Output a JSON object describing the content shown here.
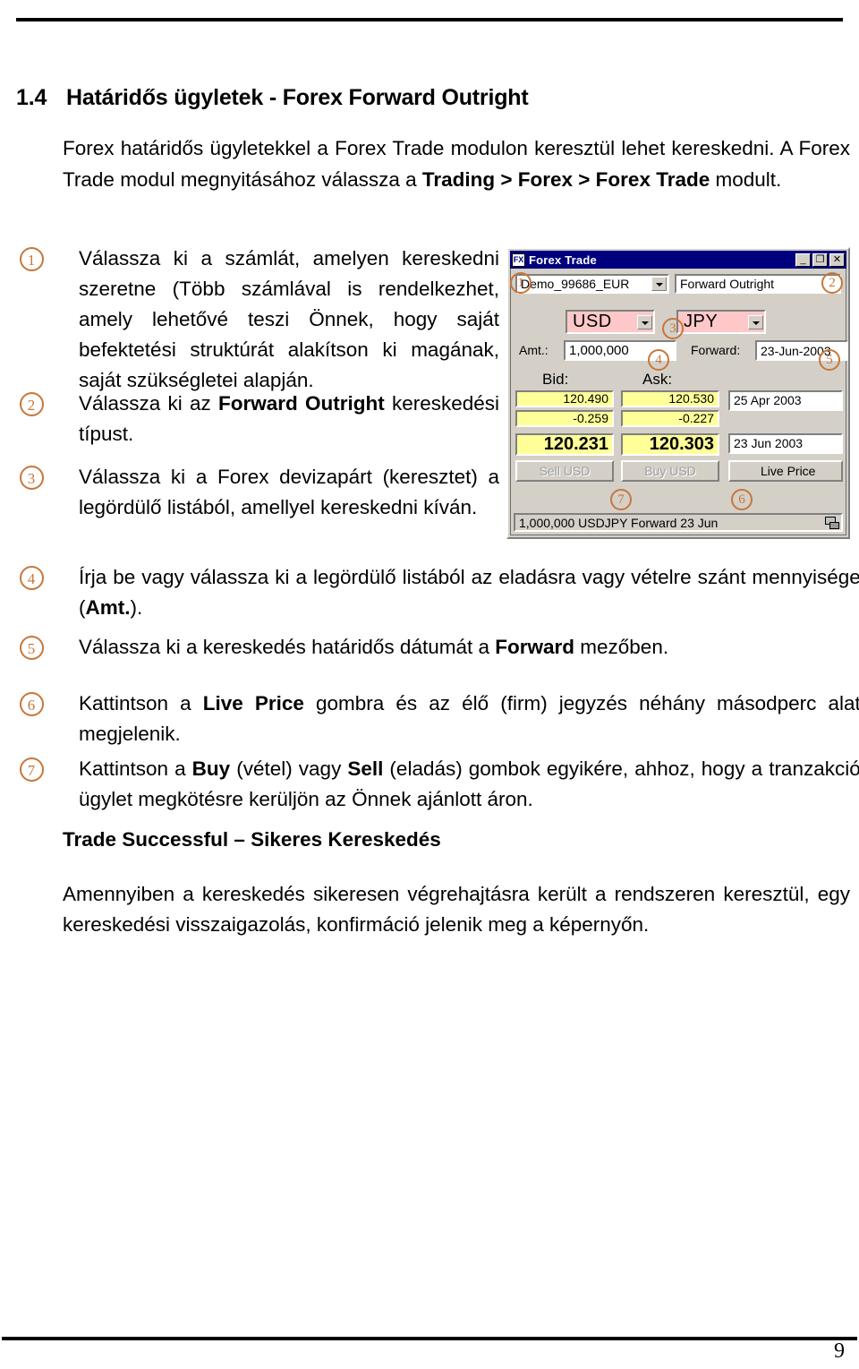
{
  "document": {
    "section_number": "1.4",
    "section_title": "Határidős ügyletek - Forex Forward Outright",
    "intro_part1": "Forex határidős ügyletekkel a Forex Trade modulon keresztül lehet kereskedni. A Forex Trade modul megnyitásához válassza a ",
    "intro_bold1": "Trading > Forex > Forex Trade",
    "intro_part2": " modult.",
    "subheading": "Trade Successful – Sikeres Kereskedés",
    "closing": "Amennyiben a kereskedés sikeresen végrehajtásra került a rendszeren keresztül, egy kereskedési visszaigazolás, konfirmáció jelenik meg a képernyőn.",
    "page_number": "9"
  },
  "steps": [
    {
      "marker": "1",
      "text": "Válassza ki a számlát, amelyen kereskedni szeretne (Több számlával is rendelkezhet, amely lehetővé teszi Önnek, hogy saját befektetési struktúrát alakítson ki magának, saját szükségletei alapján."
    },
    {
      "marker": "2",
      "pre": "Válassza ki az ",
      "bold": "Forward Outright",
      "post": " kereskedési típust."
    },
    {
      "marker": "3",
      "text": "Válassza ki a Forex devizapárt (keresztet) a legördülő listából, amellyel kereskedni kíván."
    },
    {
      "marker": "4",
      "pre": "Írja be vagy válassza ki a legördülő listából az eladásra vagy vételre szánt mennyiséget (",
      "bold": "Amt.",
      "post": ")."
    },
    {
      "marker": "5",
      "pre": "Válassza ki a kereskedés határidős dátumát a ",
      "bold": "Forward",
      "post": " mezőben."
    },
    {
      "marker": "6",
      "pre": "Kattintson a ",
      "bold": "Live Price",
      "post": " gombra és az élő (firm) jegyzés néhány másodperc alatt megjelenik."
    },
    {
      "marker": "7",
      "pre": "Kattintson a ",
      "bold": "Buy",
      "mid": " (vétel) vagy ",
      "bold2": "Sell",
      "post": " (eladás) gombok egyikére, ahhoz, hogy a tranzakció/ügylet megkötésre kerüljön az Önnek ajánlott áron."
    }
  ],
  "forex_window": {
    "logo": "FX",
    "title": "Forex Trade",
    "buttons": {
      "minimize": "_",
      "maximize": "❐",
      "close": "✕"
    },
    "account": "Demo_99686_EUR",
    "trade_type": "Forward Outright",
    "ccy_base": "USD",
    "ccy_quote": "JPY",
    "amount_label": "Amt.:",
    "amount_value": "1,000,000",
    "forward_label": "Forward:",
    "forward_value": "23-Jun-2003",
    "bid_label": "Bid:",
    "ask_label": "Ask:",
    "bid_spot": "120.490",
    "ask_spot": "120.530",
    "bid_points": "-0.259",
    "ask_points": "-0.227",
    "bid_price": "120.231",
    "ask_price": "120.303",
    "spot_date": "25 Apr 2003",
    "forward_date": "23 Jun 2003",
    "sell_button": "Sell USD",
    "buy_button": "Buy USD",
    "live_price_button": "Live Price",
    "status_text": "1,000,000 USDJPY Forward 23 Jun",
    "callouts": [
      "1",
      "2",
      "3",
      "4",
      "5",
      "6",
      "7"
    ],
    "colors": {
      "titlebar": "#00007e",
      "window_face": "#d4d0c8",
      "quote_yellow": "#ffff99",
      "currency_pink": "#ffc8c8",
      "callout_orange": "#c8763a"
    }
  }
}
